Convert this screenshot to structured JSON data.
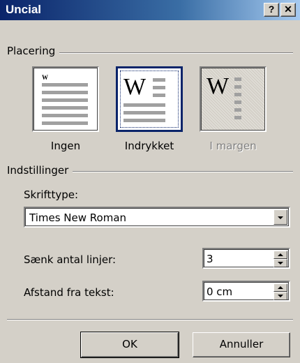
{
  "window": {
    "title": "Uncial",
    "help_button": "?",
    "close_button": "✕"
  },
  "placement": {
    "group_title": "Placering",
    "options": [
      {
        "label": "Ingen",
        "selected": false,
        "disabled": false
      },
      {
        "label": "Indrykket",
        "selected": true,
        "disabled": false
      },
      {
        "label": "I margen",
        "selected": false,
        "disabled": true
      }
    ]
  },
  "settings": {
    "group_title": "Indstillinger",
    "font_label": "Skrifttype:",
    "font_value": "Times New Roman",
    "lines_label": "Sænk antal linjer:",
    "lines_value": "3",
    "distance_label": "Afstand fra tekst:",
    "distance_value": "0 cm"
  },
  "buttons": {
    "ok": "OK",
    "cancel": "Annuller"
  },
  "colors": {
    "titlebar_start": "#0a246a",
    "titlebar_end": "#a6caf0",
    "face": "#d4d0c8"
  }
}
